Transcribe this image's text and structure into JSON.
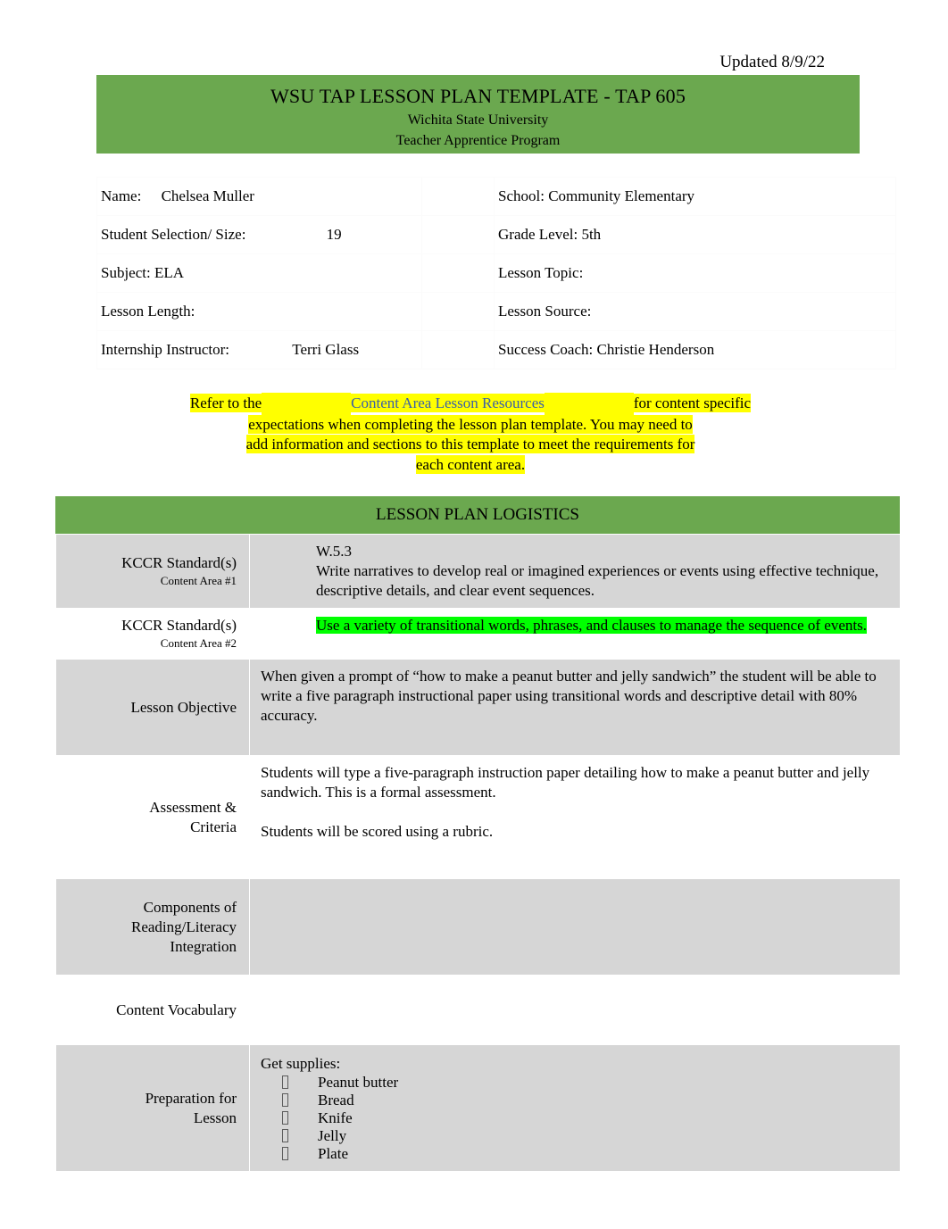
{
  "document": {
    "updated": "Updated 8/9/22",
    "title": "WSU TAP LESSON PLAN TEMPLATE - TAP 605",
    "university": "Wichita State University",
    "program": "Teacher Apprentice Program"
  },
  "colors": {
    "banner_green": "#6BA84F",
    "row_gray": "#D6D6D6",
    "highlight_yellow": "#FFFF00",
    "highlight_green": "#00FF00",
    "link_blue": "#3A5FA8"
  },
  "info": {
    "rows": [
      {
        "left_label": "Name:",
        "left_value": "Chelsea Muller",
        "right_label": "School: Community Elementary"
      },
      {
        "left_label": "Student Selection/ Size:",
        "left_value": "19",
        "right_label": "Grade Level: 5th"
      },
      {
        "left_label": "Subject: ELA",
        "left_value": "",
        "right_label": "Lesson Topic:"
      },
      {
        "left_label": "Lesson Length:",
        "left_value": "",
        "right_label": "Lesson Source:"
      },
      {
        "left_label": "Internship Instructor:",
        "left_value": "Terri Glass",
        "right_label": "Success Coach: Christie Henderson"
      }
    ]
  },
  "notice": {
    "part1": "Refer to the",
    "link": "Content Area Lesson Resources",
    "part2": "for content specific",
    "line2": "expectations when completing the lesson plan template. You may need to",
    "line3": "add information and sections to this template to meet the requirements for",
    "line4": "each content area."
  },
  "logistics": {
    "section_title": "LESSON PLAN LOGISTICS",
    "rows": [
      {
        "label": "KCCR Standard(s)",
        "sublabel": "Content Area #1",
        "code": "W.5.3",
        "text": "Write narratives to develop real or imagined experiences or events using effective technique, descriptive details, and clear event sequences."
      },
      {
        "label": "KCCR Standard(s)",
        "sublabel": "Content Area #2",
        "code": "",
        "text": "Use a variety of transitional words, phrases, and clauses to manage the sequence of events."
      },
      {
        "label": "Lesson Objective",
        "sublabel": "",
        "text": "When given a prompt of “how to make a peanut butter and jelly sandwich” the student will be able to write a five paragraph instructional paper using transitional words and descriptive detail with 80% accuracy."
      },
      {
        "label": "Assessment &\nCriteria",
        "sublabel": "",
        "text": "Students will type a five-paragraph instruction paper detailing how to make a peanut butter and jelly sandwich. This is a formal assessment.",
        "text2": "Students will be scored using a rubric."
      },
      {
        "label": "Components of\nReading/Literacy\nIntegration",
        "sublabel": "",
        "text": ""
      },
      {
        "label": "Content Vocabulary",
        "sublabel": "",
        "text": ""
      },
      {
        "label": "Preparation for\nLesson",
        "sublabel": "",
        "lead": "Get supplies:",
        "items": [
          "Peanut butter",
          "Bread",
          "Knife",
          "Jelly",
          "Plate"
        ]
      }
    ]
  },
  "icons": {
    "bullet": "tofu-box-bullet-icon"
  }
}
